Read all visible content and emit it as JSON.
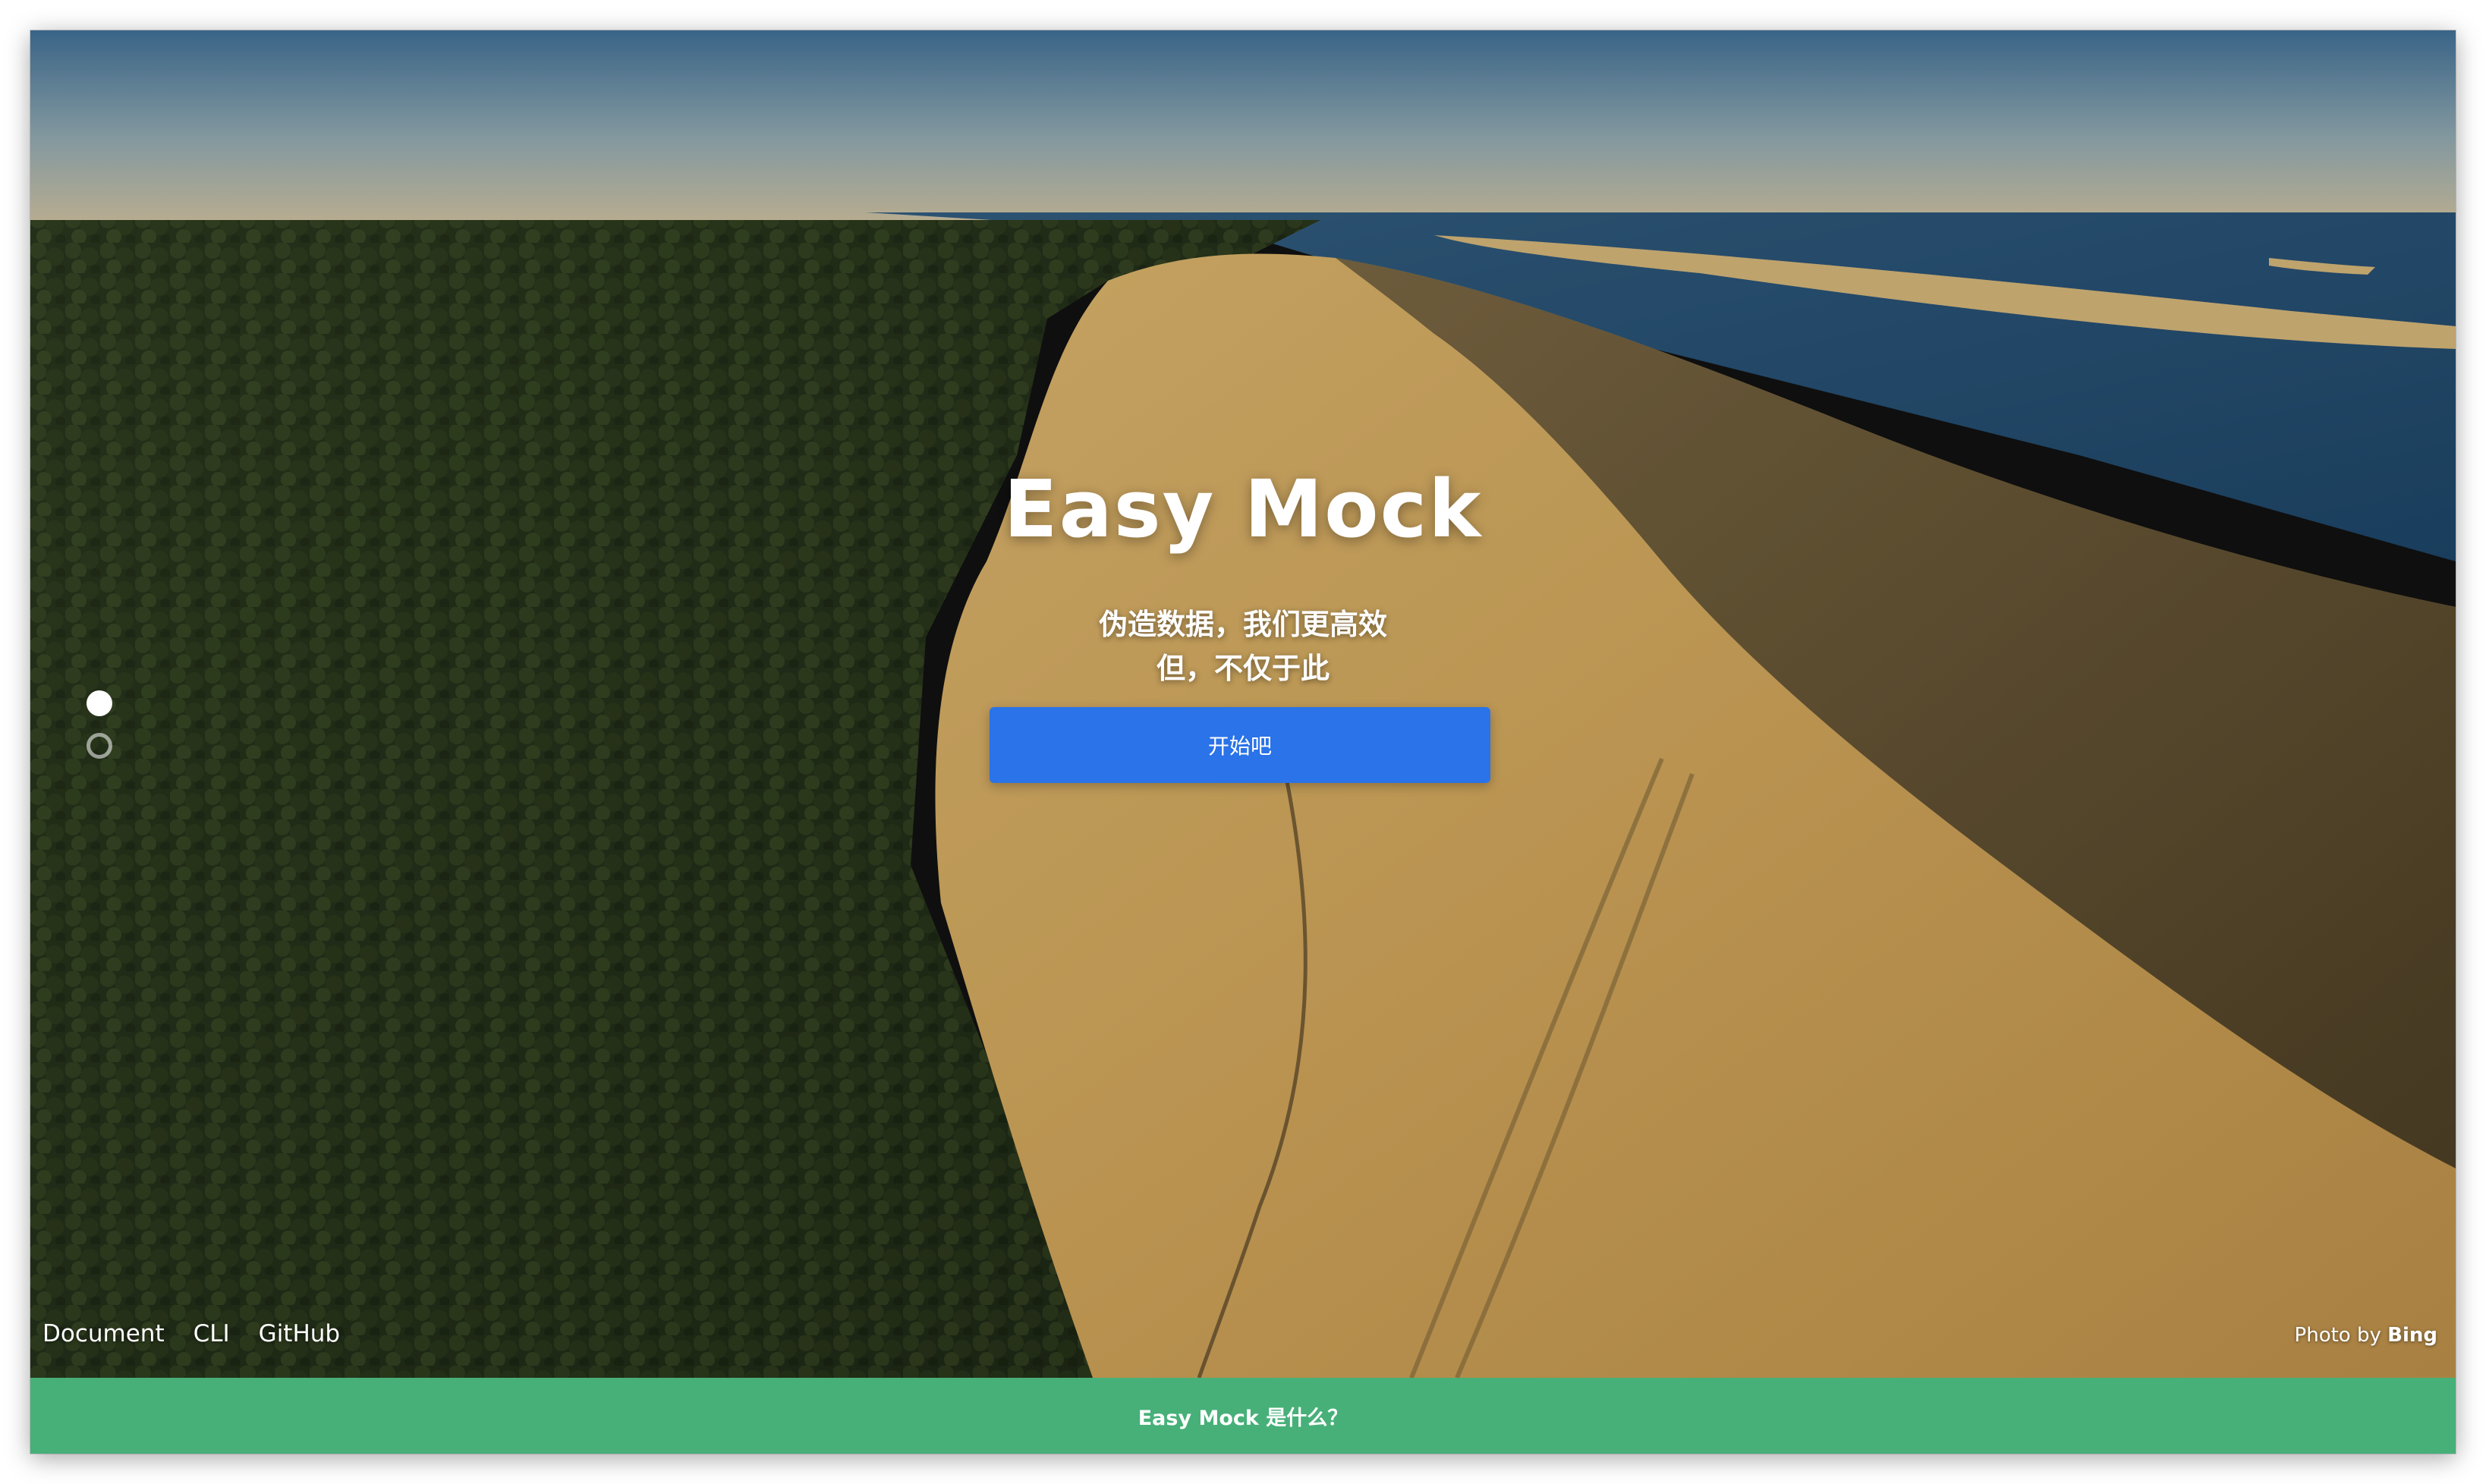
{
  "hero": {
    "title": "Easy Mock",
    "tagline_line1": "伪造数据，我们更高效",
    "tagline_line2": "但，不仅于此",
    "start_button_label": "开始吧"
  },
  "slider_dots": [
    {
      "state": "active"
    },
    {
      "state": "inactive"
    }
  ],
  "footer": {
    "links": [
      "Document",
      "CLI",
      "GitHub"
    ],
    "credit_prefix": "Photo by ",
    "credit_source": "Bing"
  },
  "bottom_bar": {
    "label": "Easy Mock 是什么？"
  },
  "colors": {
    "primary_button": "#2a73e8",
    "bottom_bar": "#46b078",
    "text": "#ffffff"
  }
}
